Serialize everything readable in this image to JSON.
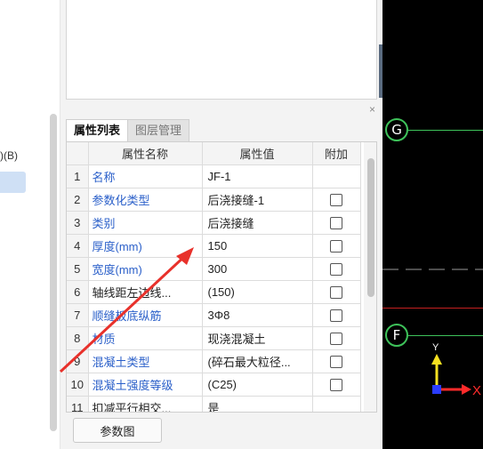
{
  "left_panel": {
    "partial_label": ")(B)"
  },
  "properties_panel": {
    "close_glyph": "×",
    "tabs": [
      {
        "label": "属性列表",
        "active": true
      },
      {
        "label": "图层管理",
        "active": false
      }
    ],
    "columns": [
      "属性名称",
      "属性值",
      "附加"
    ],
    "rows": [
      {
        "num": "1",
        "name": "名称",
        "value": "JF-1",
        "has_check": false,
        "name_color": "blue"
      },
      {
        "num": "2",
        "name": "参数化类型",
        "value": "后浇接缝-1",
        "has_check": true,
        "name_color": "blue"
      },
      {
        "num": "3",
        "name": "类别",
        "value": "后浇接缝",
        "has_check": true,
        "name_color": "blue"
      },
      {
        "num": "4",
        "name": "厚度(mm)",
        "value": "150",
        "has_check": true,
        "name_color": "blue"
      },
      {
        "num": "5",
        "name": "宽度(mm)",
        "value": "300",
        "has_check": true,
        "name_color": "blue"
      },
      {
        "num": "6",
        "name": "轴线距左边线...",
        "value": "(150)",
        "has_check": true,
        "name_color": "dark"
      },
      {
        "num": "7",
        "name": "顺缝板底纵筋",
        "value": "3Φ8",
        "has_check": true,
        "name_color": "blue"
      },
      {
        "num": "8",
        "name": "材质",
        "value": "现浇混凝土",
        "has_check": true,
        "name_color": "blue"
      },
      {
        "num": "9",
        "name": "混凝土类型",
        "value": "(碎石最大粒径...",
        "has_check": true,
        "name_color": "blue"
      },
      {
        "num": "10",
        "name": "混凝土强度等级",
        "value": "(C25)",
        "has_check": true,
        "name_color": "blue"
      },
      {
        "num": "11",
        "name": "扣减平行相交...",
        "value": "是",
        "has_check": false,
        "name_color": "dark"
      }
    ],
    "param_button_label": "参数图"
  },
  "canvas": {
    "axis_labels": [
      "G",
      "F"
    ],
    "ucs_x_label": "X",
    "ucs_y_label": "Y",
    "colors": {
      "background": "#000000",
      "axis_line": "#3ec25a",
      "red_line": "#c42020",
      "ucs_x": "#ff2b2b",
      "ucs_y": "#f5e020",
      "ucs_origin": "#2a3cff"
    }
  },
  "annotation": {
    "arrow_color": "#e8312b"
  }
}
